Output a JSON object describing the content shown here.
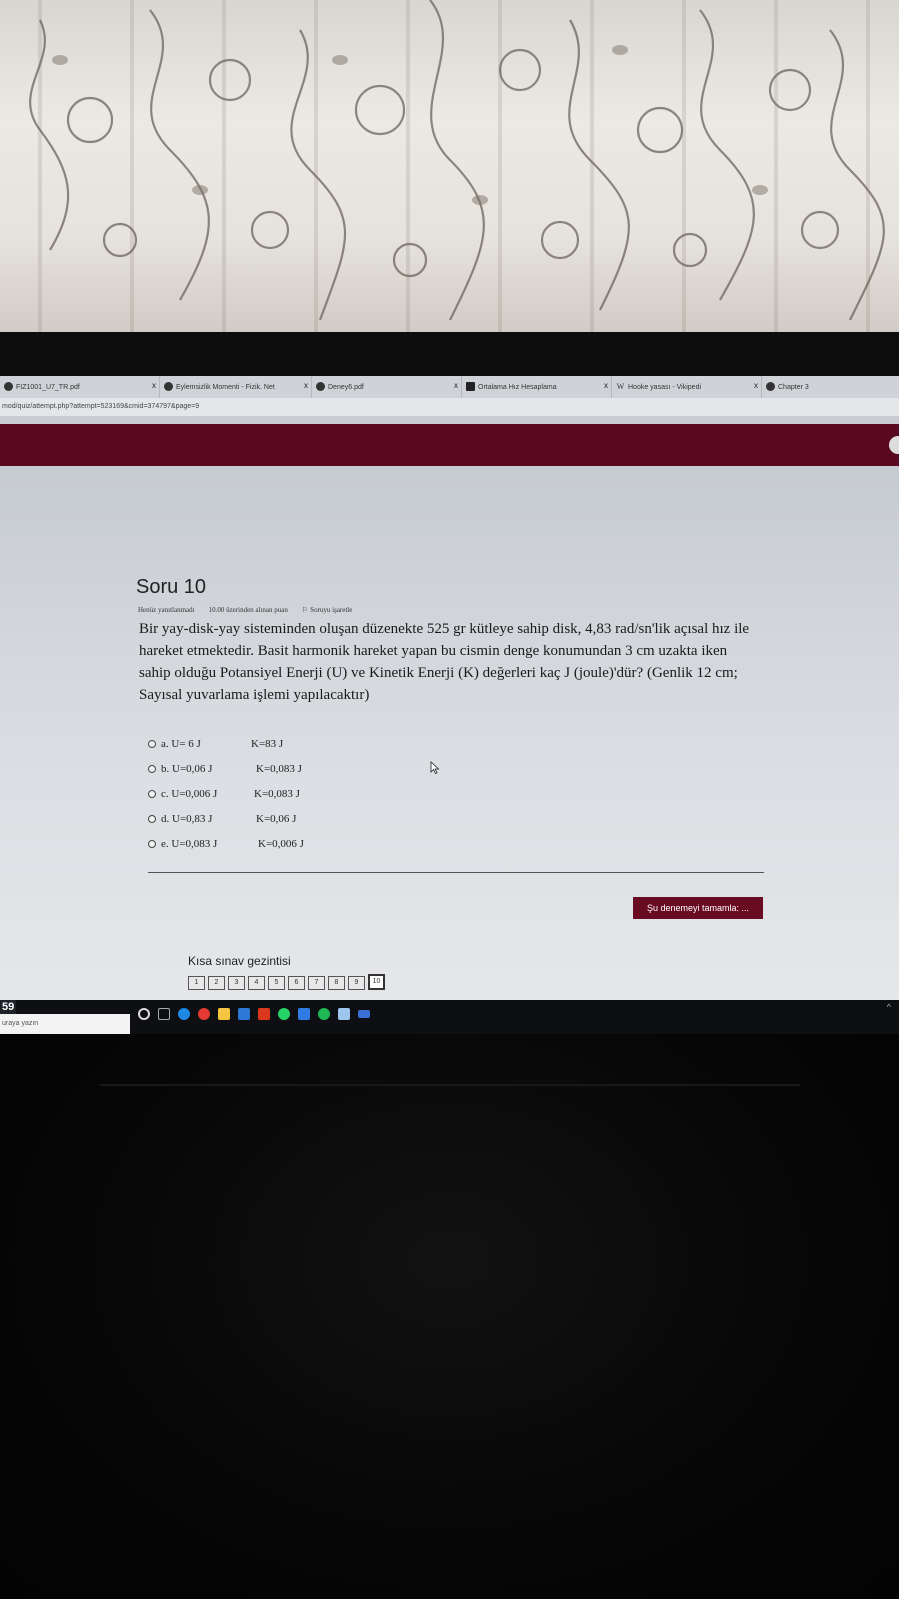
{
  "browser": {
    "tabs": [
      {
        "label": "FIZ1001_U7_TR.pdf",
        "icon": "circle-icon"
      },
      {
        "label": "Eylemsizlik Momenti - Fizik. Net",
        "icon": "circle-icon"
      },
      {
        "label": "Deney6.pdf",
        "icon": "circle-icon"
      },
      {
        "label": "Ortalama Hız Hesaplama",
        "icon": "square-icon"
      },
      {
        "label": "Hooke yasası - Vikipedi",
        "icon": "wikipedia-icon"
      },
      {
        "label": "Chapter 3",
        "icon": "circle-icon"
      }
    ],
    "url": "mod/quiz/attempt.php?attempt=523169&cmid=374797&page=9",
    "tab_close_glyph": "x"
  },
  "question": {
    "title": "Soru 10",
    "status": "Henüz yanıtlanmadı",
    "points": "10.00 üzerinden alınan puan",
    "flag_label": "Soruyu işaretle",
    "text": "Bir yay-disk-yay sisteminden oluşan düzenekte 525 gr kütleye sahip disk, 4,83 rad/sn'lik açısal hız ile hareket etmektedir. Basit harmonik hareket yapan bu cismin denge konumundan 3 cm uzakta iken sahip olduğu Potansiyel Enerji (U) ve Kinetik Enerji (K) değerleri kaç J (joule)'dür? (Genlik 12 cm; Sayısal yuvarlama işlemi yapılacaktır)",
    "answers": [
      {
        "u": "a. U= 6 J",
        "k": "K=83 J"
      },
      {
        "u": "b. U=0,06 J",
        "k": "K=0,083 J"
      },
      {
        "u": "c. U=0,006 J",
        "k": "K=0,083 J"
      },
      {
        "u": "d. U=0,83 J",
        "k": "K=0,06 J"
      },
      {
        "u": "e. U=0,083 J",
        "k": "K=0,006 J"
      }
    ]
  },
  "finish_button": "Şu denemeyi tamamla: ...",
  "quiz_nav": {
    "title": "Kısa sınav gezintisi",
    "pages": [
      "1",
      "2",
      "3",
      "4",
      "5",
      "6",
      "7",
      "8",
      "9",
      "10"
    ],
    "current": "10"
  },
  "taskbar": {
    "clock": "59",
    "search_placeholder": "uraya yazın"
  },
  "colors": {
    "header": "#5a0a20",
    "finish_button": "#6a0c21"
  }
}
